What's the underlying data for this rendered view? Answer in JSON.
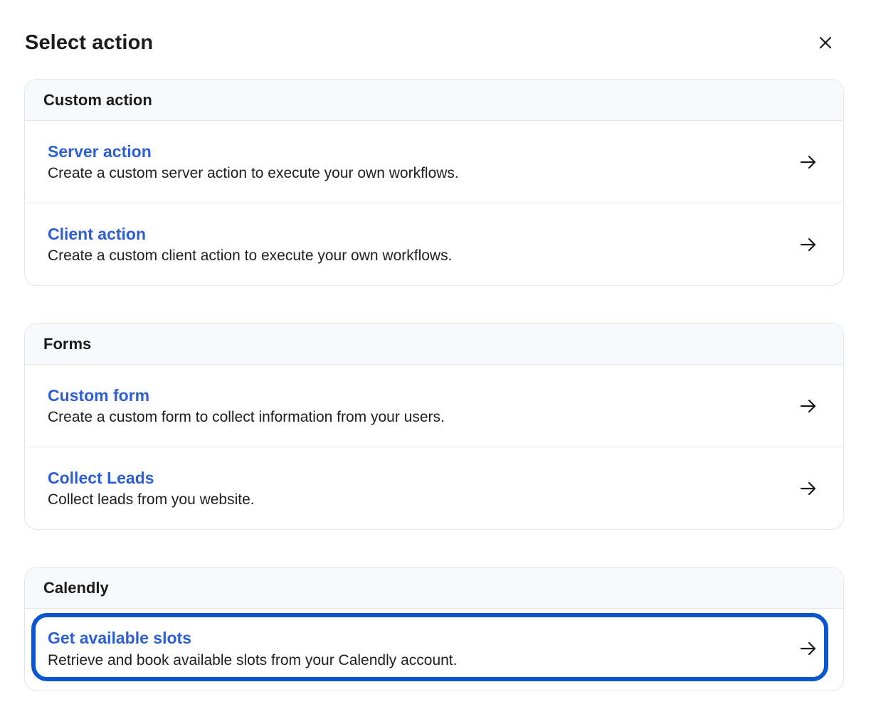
{
  "dialog": {
    "title": "Select action",
    "close_icon": "close-icon"
  },
  "sections": [
    {
      "label": "Custom action",
      "items": [
        {
          "title": "Server action",
          "description": "Create a custom server action to execute your own workflows.",
          "icon": "arrow-right-icon"
        },
        {
          "title": "Client action",
          "description": "Create a custom client action to execute your own workflows.",
          "icon": "arrow-right-icon"
        }
      ]
    },
    {
      "label": "Forms",
      "items": [
        {
          "title": "Custom form",
          "description": "Create a custom form to collect information from your users.",
          "icon": "arrow-right-icon"
        },
        {
          "title": "Collect Leads",
          "description": "Collect leads from you website.",
          "icon": "arrow-right-icon"
        }
      ]
    },
    {
      "label": "Calendly",
      "items": [
        {
          "title": "Get available slots",
          "description": "Retrieve and book available slots from your Calendly account.",
          "icon": "arrow-right-icon",
          "highlighted": true
        }
      ]
    }
  ],
  "colors": {
    "link": "#2c5fd6",
    "highlight": "#0a56d0",
    "section_header_bg": "#f7f9fb",
    "border": "#e3e6ea"
  }
}
